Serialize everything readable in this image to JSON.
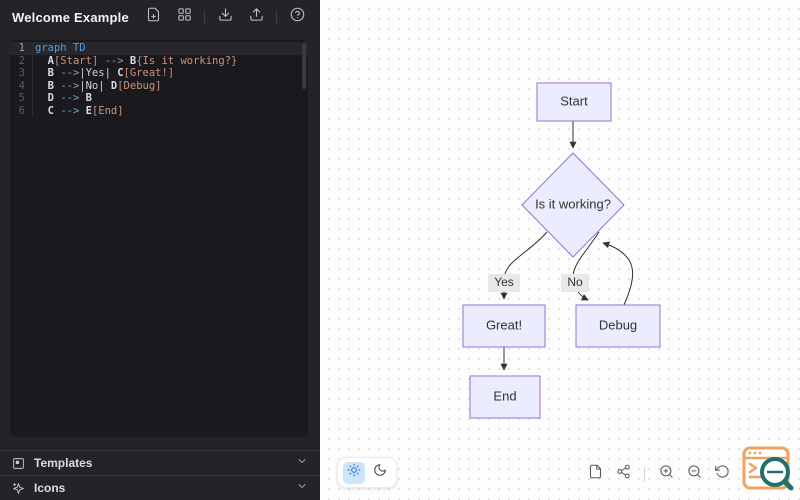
{
  "window": {
    "title": "Welcome Example"
  },
  "header": {
    "icons": [
      "new-file-icon",
      "templates-grid-icon",
      "download-icon",
      "upload-icon",
      "help-icon"
    ]
  },
  "editor": {
    "language": "mermaid",
    "lines": [
      {
        "n": "1",
        "active": true,
        "tokens": [
          [
            "kw",
            "graph"
          ],
          [
            "pl",
            " "
          ],
          [
            "kw",
            "TD"
          ]
        ]
      },
      {
        "n": "2",
        "active": false,
        "tokens": [
          [
            "pl",
            "  "
          ],
          [
            "id",
            "A"
          ],
          [
            "str",
            "[Start]"
          ],
          [
            "pl",
            " "
          ],
          [
            "op",
            "-->"
          ],
          [
            "pl",
            " "
          ],
          [
            "id",
            "B"
          ],
          [
            "str",
            "{Is it working?}"
          ]
        ]
      },
      {
        "n": "3",
        "active": false,
        "tokens": [
          [
            "pl",
            "  "
          ],
          [
            "id",
            "B"
          ],
          [
            "pl",
            " "
          ],
          [
            "op",
            "-->"
          ],
          [
            "pipe",
            "|Yes|"
          ],
          [
            "pl",
            " "
          ],
          [
            "id",
            "C"
          ],
          [
            "str",
            "[Great!]"
          ]
        ]
      },
      {
        "n": "4",
        "active": false,
        "tokens": [
          [
            "pl",
            "  "
          ],
          [
            "id",
            "B"
          ],
          [
            "pl",
            " "
          ],
          [
            "op",
            "-->"
          ],
          [
            "pipe",
            "|No|"
          ],
          [
            "pl",
            " "
          ],
          [
            "id",
            "D"
          ],
          [
            "str",
            "[Debug]"
          ]
        ]
      },
      {
        "n": "5",
        "active": false,
        "tokens": [
          [
            "pl",
            "  "
          ],
          [
            "id",
            "D"
          ],
          [
            "pl",
            " "
          ],
          [
            "op",
            "-->"
          ],
          [
            "pl",
            " "
          ],
          [
            "id",
            "B"
          ]
        ]
      },
      {
        "n": "6",
        "active": false,
        "tokens": [
          [
            "pl",
            "  "
          ],
          [
            "id",
            "C"
          ],
          [
            "pl",
            " "
          ],
          [
            "op",
            "-->"
          ],
          [
            "pl",
            " "
          ],
          [
            "id",
            "E"
          ],
          [
            "str",
            "[End]"
          ]
        ]
      }
    ]
  },
  "sidebar_footer": {
    "templates_label": "Templates",
    "icons_label": "Icons"
  },
  "flowchart": {
    "nodes": {
      "start": {
        "label": "Start"
      },
      "decision": {
        "label": "Is it working?"
      },
      "great": {
        "label": "Great!"
      },
      "debug": {
        "label": "Debug"
      },
      "end": {
        "label": "End"
      }
    },
    "edge_labels": {
      "yes": "Yes",
      "no": "No"
    }
  },
  "canvas_toolbar": {
    "icons": [
      "copy-diagram-icon",
      "share-icon",
      "zoom-in-icon",
      "zoom-out-icon",
      "reset-view-icon"
    ]
  },
  "theme_toggle": {
    "active": "light",
    "icons": [
      "sun-icon",
      "moon-icon"
    ]
  },
  "colors": {
    "panel_bg": "#242428",
    "editor_bg": "#1a1a1e",
    "node_fill": "#ECECFF",
    "node_stroke": "#9370DB",
    "keyword_blue": "#569cd6",
    "string_orange": "#ce9178",
    "widget_orange": "#f0a35e",
    "widget_teal": "#20706c"
  }
}
